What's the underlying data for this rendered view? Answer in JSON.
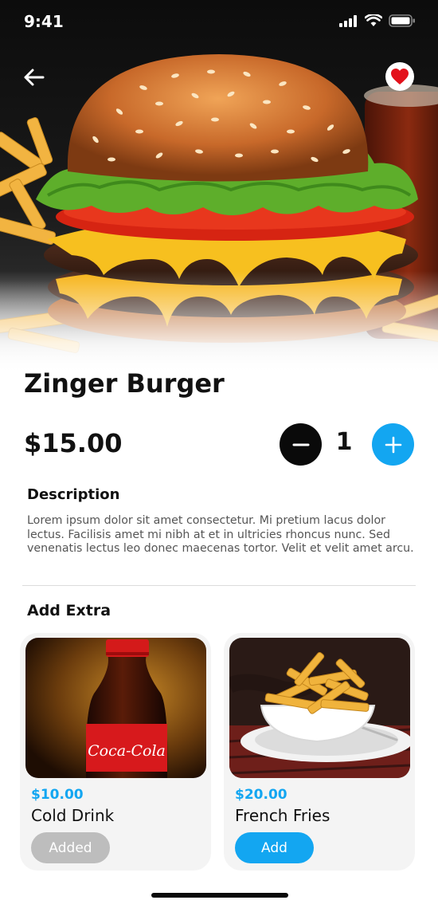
{
  "status_bar": {
    "time": "9:41"
  },
  "product": {
    "name": "Zinger Burger",
    "price": "$15.00",
    "quantity": "1"
  },
  "description": {
    "heading": "Description",
    "text": "Lorem ipsum dolor sit amet consectetur. Mi pretium lacus dolor lectus. Facilisis amet mi nibh at et in ultricies rhoncus nunc. Sed venenatis lectus leo donec maecenas tortor. Velit et velit amet arcu."
  },
  "extras": {
    "heading": "Add Extra",
    "items": [
      {
        "price": "$10.00",
        "name": "Cold Drink",
        "button": "Added",
        "state": "added",
        "image_text": "Coca-Cola"
      },
      {
        "price": "$20.00",
        "name": "French Fries",
        "button": "Add",
        "state": "default"
      }
    ]
  },
  "colors": {
    "accent": "#13a6f1",
    "dark": "#0a0a0a",
    "favorite": "#e3111b",
    "added_button": "#bdbdbd"
  },
  "icons": [
    "back-arrow-icon",
    "heart-icon",
    "minus-icon",
    "plus-icon",
    "signal-icon",
    "wifi-icon",
    "battery-icon"
  ]
}
